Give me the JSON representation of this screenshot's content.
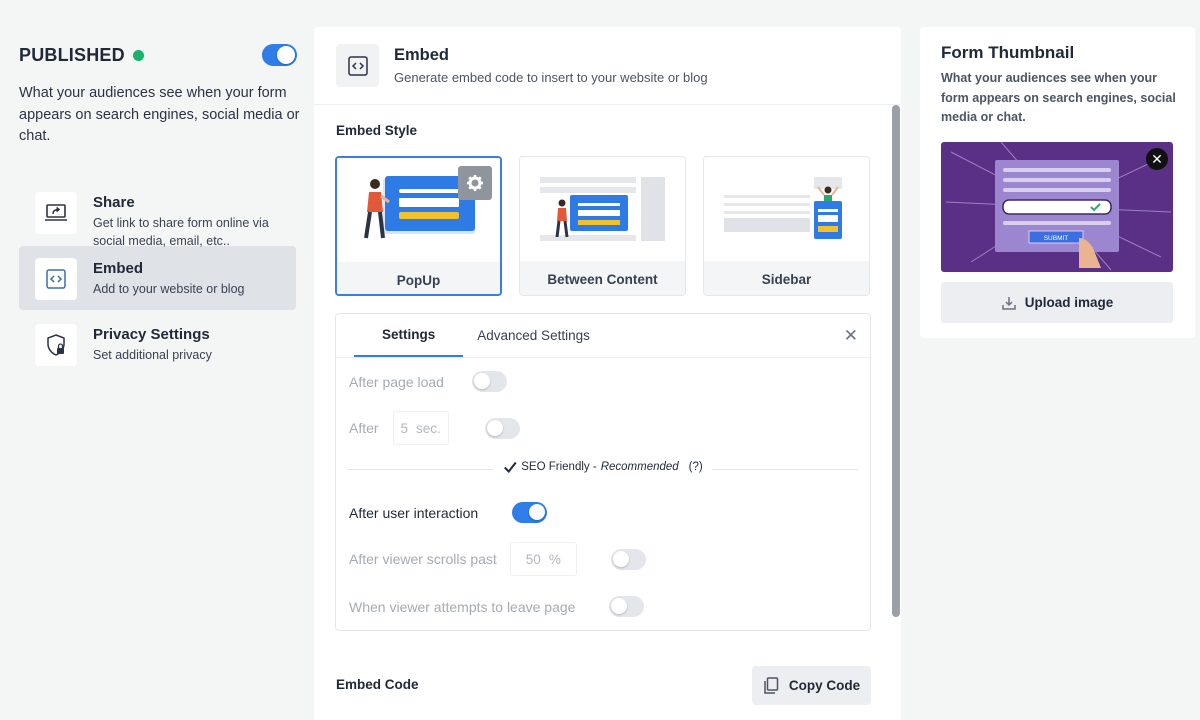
{
  "status": {
    "title": "PUBLISHED",
    "dot_color": "#18b36b",
    "toggle_on": true,
    "description": "What your audiences see when your form appears on search engines, social media or chat."
  },
  "nav": {
    "items": [
      {
        "title": "Share",
        "subtitle": "Get link to share form online via social media, email, etc..",
        "icon": "share-screen-icon"
      },
      {
        "title": "Embed",
        "subtitle": "Add to your website or blog",
        "icon": "code-icon",
        "active": true
      },
      {
        "title": "Privacy Settings",
        "subtitle": "Set additional privacy",
        "icon": "shield-lock-icon"
      }
    ]
  },
  "embed": {
    "header_title": "Embed",
    "header_subtitle": "Generate embed code to insert to your website or blog",
    "style_label": "Embed Style",
    "styles": [
      {
        "label": "PopUp",
        "selected": true
      },
      {
        "label": "Between Content"
      },
      {
        "label": "Sidebar"
      }
    ],
    "tabs": [
      "Settings",
      "Advanced Settings"
    ],
    "active_tab": "Settings",
    "settings": {
      "after_page_load": {
        "label": "After page load",
        "enabled": false
      },
      "after_seconds": {
        "label": "After",
        "value": "5",
        "unit": "sec.",
        "enabled": false
      },
      "seo_note": {
        "prefix": "SEO Friendly - ",
        "emphasis": "Recommended",
        "help": "(?)"
      },
      "after_user_interaction": {
        "label": "After user interaction",
        "enabled": true
      },
      "after_scroll": {
        "label": "After viewer scrolls past",
        "value": "50",
        "unit": "%",
        "enabled": false
      },
      "exit_intent": {
        "label": "When viewer attempts to leave page",
        "enabled": false
      }
    },
    "code_label": "Embed Code",
    "copy_label": "Copy Code"
  },
  "thumbnail": {
    "title": "Form Thumbnail",
    "description": "What your audiences see when your form appears on search engines, social media or chat.",
    "image_text": "SUBMIT",
    "upload_label": "Upload image"
  },
  "colors": {
    "accent": "#2e7de8",
    "thumbnail_bg": "#5a2f86",
    "card_blue": "#2f7be6",
    "card_yellow": "#f2c12e"
  }
}
